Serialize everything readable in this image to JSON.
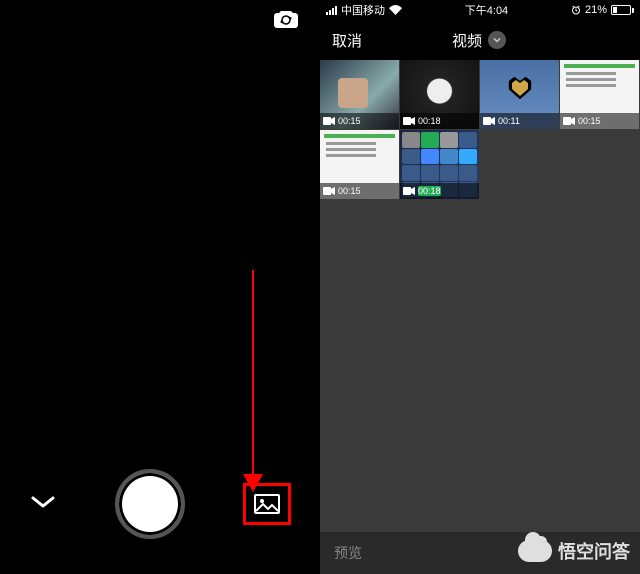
{
  "left": {
    "icons": {
      "camera_switch": "camera-switch-icon",
      "chevron": "chevron-down-icon",
      "gallery": "picture-icon"
    }
  },
  "right": {
    "status": {
      "carrier": "中国移动",
      "time": "下午4:04",
      "battery_pct": "21%"
    },
    "nav": {
      "cancel": "取消",
      "title": "视频"
    },
    "thumbs": [
      {
        "duration": "00:15"
      },
      {
        "duration": "00:18"
      },
      {
        "duration": "00:11"
      },
      {
        "duration": "00:15"
      },
      {
        "duration": "00:15"
      },
      {
        "duration": "00:18"
      }
    ],
    "bottom": {
      "preview": "预览"
    }
  },
  "watermark": "悟空问答"
}
